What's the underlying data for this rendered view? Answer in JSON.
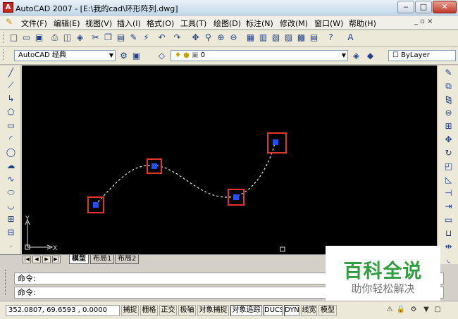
{
  "window": {
    "title": "AutoCAD 2007 - [E:\\我的cad\\环形阵列.dwg]",
    "app_icon": "A",
    "minimize_icon": "‒",
    "maximize_icon": "□",
    "close_icon": "✕"
  },
  "menu": {
    "items": [
      "文件(F)",
      "编辑(E)",
      "视图(V)",
      "插入(I)",
      "格式(O)",
      "工具(T)",
      "绘图(D)",
      "标注(N)",
      "修改(M)",
      "窗口(W)",
      "帮助(H)"
    ],
    "doc_controls": "_ ▫ ×"
  },
  "toolbar": {
    "workspace": "AutoCAD 经典",
    "layer": "0",
    "linetype": "ByLayer"
  },
  "canvas": {
    "background": "#000000",
    "grip_color": "#1f4fff",
    "highlight_color": "#e2372f",
    "ucs_x_label": "X",
    "ucs_y_label": "Y"
  },
  "layout_tabs": [
    "模型",
    "布局1",
    "布局2"
  ],
  "command": {
    "line1": "命令:",
    "line2": "命令:"
  },
  "status": {
    "coordinates": "352.0807, 69.6593 , 0.0000",
    "buttons": [
      "捕捉",
      "栅格",
      "正交",
      "极轴",
      "对象捕捉",
      "对象追踪",
      "DUCS",
      "DYN",
      "线宽",
      "模型"
    ]
  },
  "watermark": {
    "title": "百科全说",
    "subtitle": "助你轻松解决"
  }
}
